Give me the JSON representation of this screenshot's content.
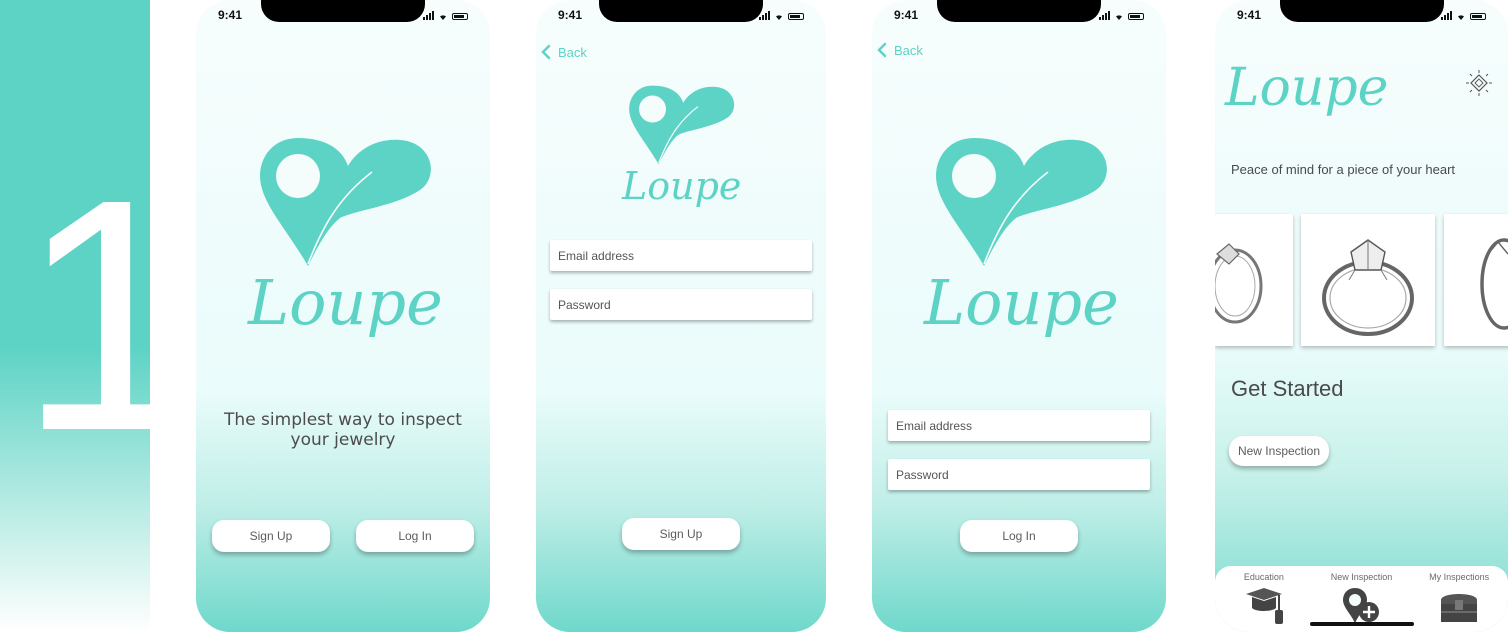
{
  "step": {
    "number": "1"
  },
  "colors": {
    "brand": "#5dd3c5",
    "text": "#4a4a4a"
  },
  "status": {
    "time": "9:41"
  },
  "brand": {
    "name": "Loupe"
  },
  "screen1": {
    "tagline": "The simplest way to inspect your jewelry",
    "signup_label": "Sign Up",
    "login_label": "Log In"
  },
  "screen2": {
    "back_label": "Back",
    "email_placeholder": "Email address",
    "password_placeholder": "Password",
    "signup_label": "Sign Up"
  },
  "screen3": {
    "back_label": "Back",
    "email_placeholder": "Email address",
    "password_placeholder": "Password",
    "login_label": "Log In"
  },
  "screen4": {
    "tagline": "Peace of mind for a piece of your heart",
    "section_title": "Get Started",
    "new_inspection_label": "New Inspection",
    "tabs": [
      {
        "label": "Education",
        "icon": "graduation-cap-icon"
      },
      {
        "label": "New Inspection",
        "icon": "location-pin-plus-icon"
      },
      {
        "label": "My Inspections",
        "icon": "treasure-chest-icon"
      }
    ]
  }
}
